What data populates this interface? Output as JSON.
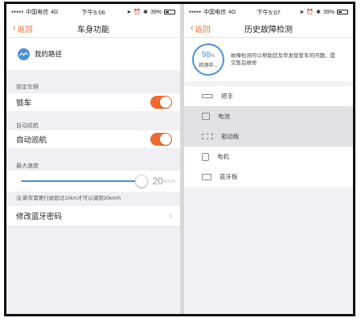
{
  "left": {
    "status": {
      "carrier": "中国电信",
      "network": "4G",
      "time": "下午5:06",
      "battery": "39%"
    },
    "nav": {
      "back_label": "返回",
      "title": "车身功能"
    },
    "route": {
      "label": "我的路径"
    },
    "lock_section": {
      "label": "锁定车辆",
      "row_label": "锁车",
      "on": true
    },
    "cruise_section": {
      "label": "自动巡航",
      "row_label": "自动巡航",
      "on": true
    },
    "speed_section": {
      "label": "最大速度",
      "value": "20",
      "unit": "km/h",
      "fraction": 1.0
    },
    "note": "注:新车需要行驶超过10km才可以调到30km/h",
    "password_row": {
      "label": "修改蓝牙密码",
      "arrow": "›"
    }
  },
  "right": {
    "status": {
      "carrier": "中国电信",
      "network": "4G",
      "time": "下午5:07",
      "battery": "39%"
    },
    "nav": {
      "back_label": "返回",
      "title": "历史故障检测"
    },
    "gauge": {
      "value": "98",
      "unit": "%",
      "label": "检测中..."
    },
    "description": "故障检测可以帮助您及早发现爱车的问题，提交售后维修",
    "parts": [
      {
        "label": "把手",
        "icon": "handle-icon",
        "highlighted": false
      },
      {
        "label": "电池",
        "icon": "battery-part-icon",
        "highlighted": true
      },
      {
        "label": "驱动板",
        "icon": "driver-board-icon",
        "highlighted": true
      },
      {
        "label": "电机",
        "icon": "motor-icon",
        "highlighted": false
      },
      {
        "label": "蓝牙板",
        "icon": "bluetooth-board-icon",
        "highlighted": false
      }
    ]
  },
  "colors": {
    "accent": "#f06a2e",
    "blue": "#4a90d9"
  }
}
